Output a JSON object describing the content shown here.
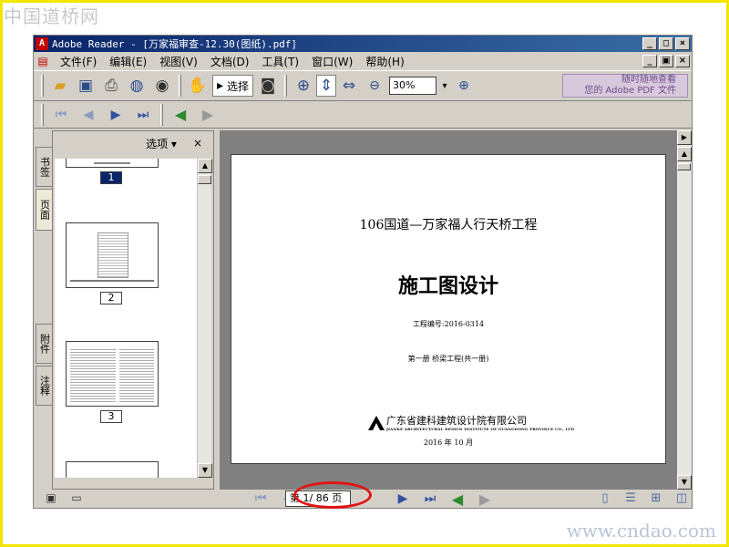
{
  "watermark": {
    "top": "中国道桥网",
    "bottom": "www.cndao.com"
  },
  "window": {
    "title": "Adobe Reader - [万家福审查-12.30(图纸).pdf]",
    "controls": {
      "minimize": "_",
      "maximize": "□",
      "close": "×"
    },
    "doc_controls": {
      "minimize": "_",
      "restore": "▣",
      "close": "×"
    }
  },
  "menu": {
    "items": [
      "文件(F)",
      "编辑(E)",
      "视图(V)",
      "文档(D)",
      "工具(T)",
      "窗口(W)",
      "帮助(H)"
    ]
  },
  "toolbar": {
    "select_label": "选择",
    "zoom_value": "30%",
    "promo_line1": "随时随地查看",
    "promo_line2": "您的 Adobe PDF 文件"
  },
  "navpane": {
    "options_label": "选项",
    "options_arrow": "▾",
    "close_label": "×",
    "tabs": [
      "书签",
      "页面",
      "附件",
      "注释"
    ],
    "thumbnails": [
      {
        "label": "1",
        "selected": true
      },
      {
        "label": "2",
        "selected": false
      },
      {
        "label": "3",
        "selected": false
      }
    ]
  },
  "page": {
    "project_title": "106国道—万家福人行天桥工程",
    "main_title": "施工图设计",
    "project_number": "工程编号:2016-0314",
    "volume": "第一册  桥梁工程(共一册)",
    "organization": "广东省建科建筑设计院有限公司",
    "organization_en": "JIANKE ARCHITECTURAL DESIGN INSTITUTE OF GUANGDONG PROVINCE CO., LTD",
    "date": "2016 年 10 月"
  },
  "statusbar": {
    "page_indicator": "第 1/ 86 页"
  },
  "colors": {
    "frame": "#f3e600",
    "titlebar": "#0a246a",
    "highlight": "#e01414",
    "window_bg": "#d4d0c8"
  },
  "icons": [
    "open-icon",
    "save-icon",
    "print-icon",
    "email-icon",
    "search-icon",
    "hand-icon",
    "select-icon",
    "snapshot-icon",
    "zoom-in-icon",
    "fit-page-icon",
    "fit-width-icon",
    "zoom-out-minus-icon",
    "zoom-in-plus-icon",
    "first-page-icon",
    "prev-page-icon",
    "next-page-icon",
    "last-page-icon",
    "back-icon",
    "forward-icon"
  ]
}
